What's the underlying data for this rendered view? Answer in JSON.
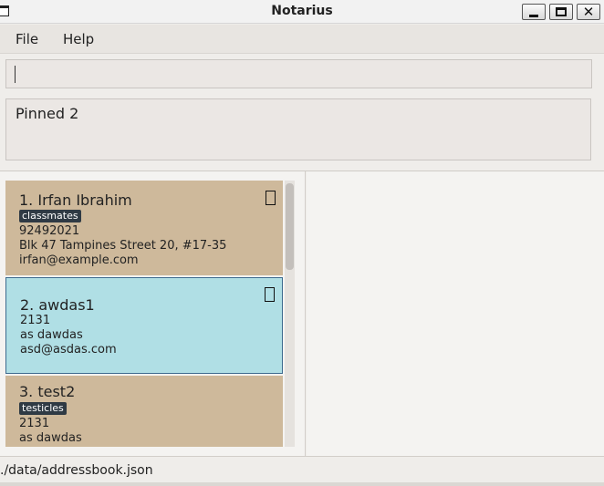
{
  "window": {
    "title": "Notarius"
  },
  "menu": {
    "items": [
      "File",
      "Help"
    ]
  },
  "command": {
    "value": ""
  },
  "result": {
    "text": "Pinned 2"
  },
  "persons": [
    {
      "index_name": "1. Irfan Ibrahim",
      "tag": "classmates",
      "phone": "92492021",
      "address": "Blk 47 Tampines Street 20, #17-35",
      "email": "irfan@example.com",
      "pinned": true,
      "selected": false
    },
    {
      "index_name": "2. awdas1",
      "tag": "",
      "phone": "2131",
      "address": "as dawdas",
      "email": "asd@asdas.com",
      "pinned": true,
      "selected": true
    },
    {
      "index_name": "3. test2",
      "tag": "testicles",
      "phone": "2131",
      "address": "as dawdas",
      "email": "",
      "pinned": false,
      "selected": false
    }
  ],
  "status": {
    "path": "./data/addressbook.json"
  },
  "icons": {
    "app": "app-window-icon",
    "pin": "pin-icon",
    "minimize": "minimize-icon",
    "maximize": "maximize-icon",
    "close": "close-icon"
  },
  "colors": {
    "card": "#ceb99b",
    "card_selected": "#b0dfe5",
    "tag": "#2f3a44"
  }
}
